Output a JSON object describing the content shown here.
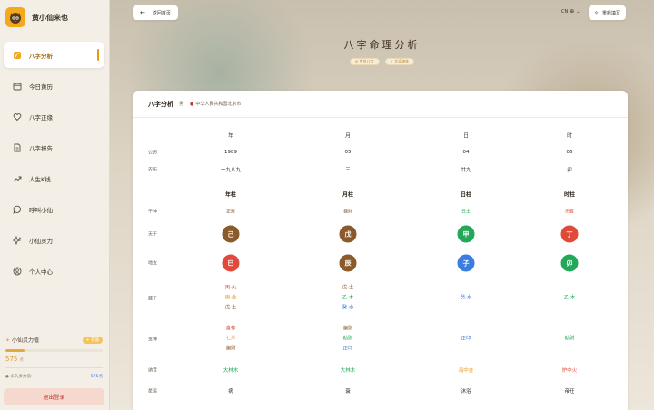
{
  "app": {
    "title": "黄小仙来也"
  },
  "sidebar": {
    "items": [
      {
        "label": "八字分析",
        "icon": "bazi-icon",
        "active": true
      },
      {
        "label": "今日黄历",
        "icon": "calendar-icon"
      },
      {
        "label": "八字正缘",
        "icon": "heart-icon"
      },
      {
        "label": "八字报告",
        "icon": "report-icon"
      },
      {
        "label": "人生K线",
        "icon": "trend-icon"
      },
      {
        "label": "呼叫小仙",
        "icon": "chat-icon"
      },
      {
        "label": "小仙灵力",
        "icon": "sparkle-icon"
      },
      {
        "label": "个人中心",
        "icon": "user-icon"
      }
    ],
    "energy": {
      "label": "小仙灵力值",
      "badge": "+ 充值",
      "value": "575",
      "unit": "点",
      "level": 0.2,
      "forever_label": "● 永久灵力值:",
      "forever_value": "575点"
    },
    "logout": "退出登录"
  },
  "topbar": {
    "back": "返回首页",
    "lang": "CN",
    "refill": "重新填写"
  },
  "page": {
    "title": "八字命理分析",
    "tags": [
      "◎ 专业八字",
      "✧ 大运流年"
    ]
  },
  "card": {
    "title": "八字分析",
    "gender": "男",
    "location": "中华人民共和国北京市",
    "columns": [
      "年",
      "月",
      "日",
      "时"
    ],
    "rows": {
      "gongli": {
        "label": "公历",
        "values": [
          "1989",
          "05",
          "04",
          "06"
        ]
      },
      "nongli": {
        "label": "农历",
        "values": [
          "一九八九",
          "三",
          "廿九",
          "卯"
        ]
      },
      "pillars": {
        "values": [
          "年柱",
          "月柱",
          "日柱",
          "时柱"
        ]
      },
      "shishen": {
        "label": "干神",
        "values": [
          "正财",
          "偏财",
          "日主",
          "伤官"
        ]
      },
      "tiangan": {
        "label": "天干",
        "values": [
          "己",
          "戊",
          "甲",
          "丁"
        ]
      },
      "dizhi": {
        "label": "地支",
        "values": [
          "巳",
          "辰",
          "子",
          "卯"
        ]
      },
      "canggan": {
        "label": "藏干",
        "values": [
          [
            "丙·火",
            "庚·金",
            "戊·土"
          ],
          [
            "戊·土",
            "乙·木",
            "癸·水"
          ],
          [
            "癸·水"
          ],
          [
            "乙·木"
          ]
        ]
      },
      "zhishen": {
        "label": "支神",
        "values": [
          [
            "食神",
            "七杀",
            "偏财"
          ],
          [
            "偏财",
            "劫财",
            "正印"
          ],
          [
            "正印"
          ],
          [
            "劫财"
          ]
        ]
      },
      "nayin": {
        "label": "纳音",
        "values": [
          "大林木",
          "大林木",
          "海中金",
          "炉中火"
        ]
      },
      "xingyun": {
        "label": "星运",
        "values": [
          "病",
          "衰",
          "沐浴",
          "帝旺"
        ]
      }
    }
  },
  "colors": {
    "accent": "#e79a10",
    "fire": "#e04a3a",
    "earth": "#8a5a2b",
    "wood": "#23a85a",
    "water": "#3c7de0",
    "metal": "#e59a1f"
  }
}
